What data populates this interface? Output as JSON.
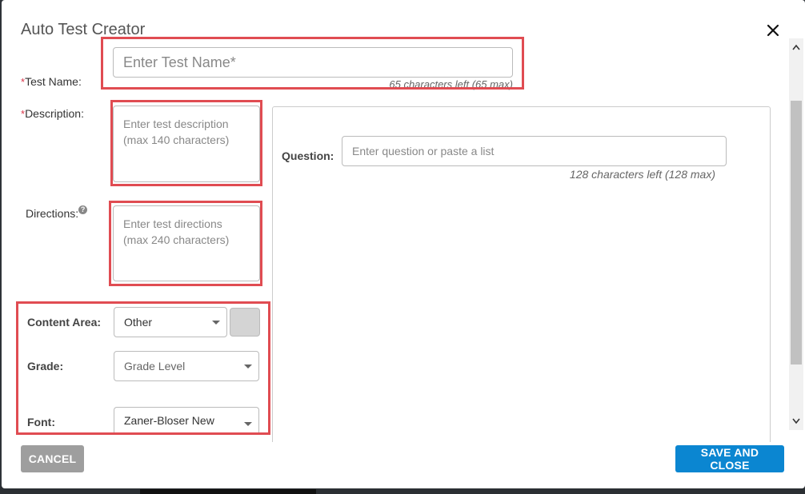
{
  "modal": {
    "title": "Auto Test Creator"
  },
  "test_name": {
    "required_mark": "*",
    "label": "Test Name:",
    "placeholder": "Enter Test Name*",
    "counter": "65 characters left (65 max)"
  },
  "description": {
    "required_mark": "*",
    "label": "Description:",
    "placeholder": "Enter test description (max 140 characters)"
  },
  "directions": {
    "label": "Directions:",
    "help_icon": "question-circle-icon",
    "help_glyph": "?",
    "placeholder": "Enter test directions (max 240 characters)"
  },
  "question": {
    "label": "Question:",
    "placeholder": "Enter question or paste a list",
    "counter": "128 characters left (128 max)"
  },
  "content_area": {
    "label": "Content Area:",
    "value": "Other",
    "color_swatch": "#d4d4d4"
  },
  "grade": {
    "label": "Grade:",
    "value": "Grade Level"
  },
  "font": {
    "label": "Font:",
    "value": "Zaner-Bloser New"
  },
  "buttons": {
    "cancel": "CANCEL",
    "save_and_close": "SAVE AND CLOSE"
  },
  "colors": {
    "primary_button": "#0b86d1",
    "cancel_button": "#9e9e9e",
    "highlight_box": "#e04c52",
    "required_asterisk": "#d9364a"
  }
}
